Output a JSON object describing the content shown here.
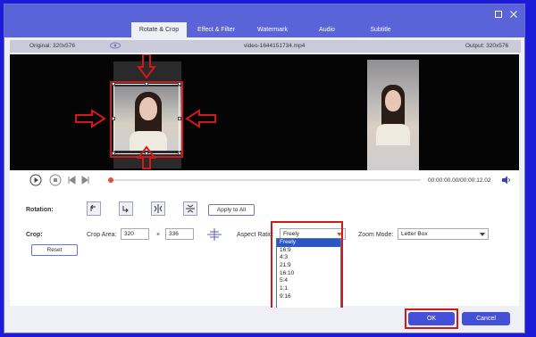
{
  "window": {
    "tabs": [
      "Rotate & Crop",
      "Effect & Filter",
      "Watermark",
      "Audio",
      "Subtitle"
    ],
    "active_tab": 0,
    "minimize_icon": "square-icon",
    "close_icon": "close-icon"
  },
  "infobar": {
    "original": "Original: 320x576",
    "filename": "video-1644151734.mp4",
    "output": "Output: 320x576"
  },
  "playback": {
    "time": "00:00:00.00/00:00:12.02",
    "progress": 0.0
  },
  "rotation": {
    "label": "Rotation:",
    "apply_label": "Apply to All"
  },
  "crop": {
    "label": "Crop:",
    "area_label": "Crop Area:",
    "width": "320",
    "height": "336",
    "times": "×",
    "reset_label": "Reset"
  },
  "aspect": {
    "label": "Aspect Ratio:",
    "value": "Freely",
    "options": [
      "Freely",
      "16:9",
      "4:3",
      "21:9",
      "16:10",
      "5:4",
      "1:1",
      "9:16"
    ]
  },
  "zoom": {
    "label": "Zoom Mode:",
    "value": "Letter Box"
  },
  "footer": {
    "ok_label": "OK",
    "cancel_label": "Cancel"
  },
  "colors": {
    "accent": "#5b63d8",
    "highlight": "#d01a1a",
    "selected": "#2b56c8"
  }
}
